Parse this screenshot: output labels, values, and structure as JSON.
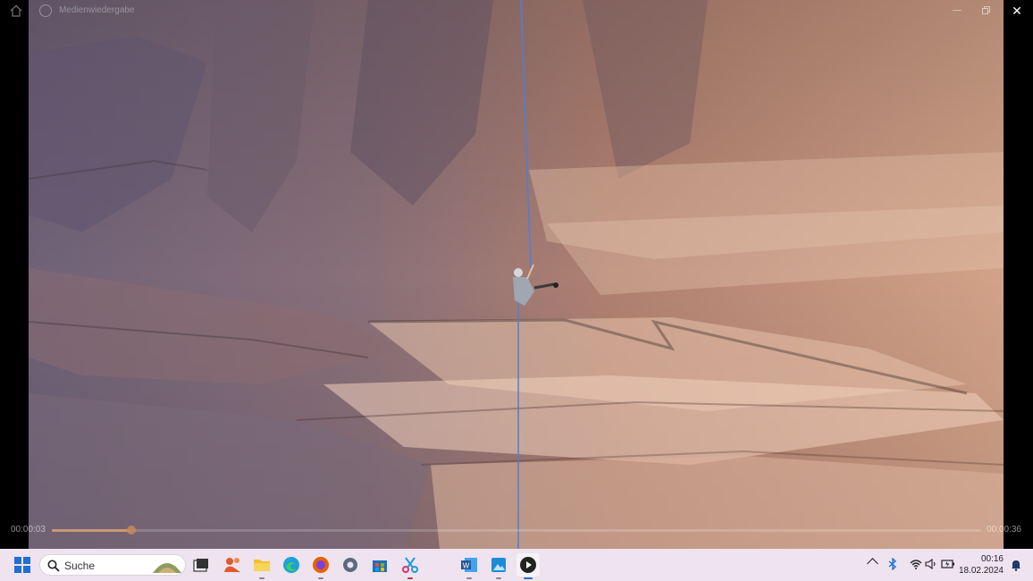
{
  "window": {
    "title": "Medienwiedergabe"
  },
  "playback": {
    "elapsed": "00:00:03",
    "total": "00:00:36",
    "progress_fraction": 0.086
  },
  "taskbar": {
    "search_label": "Suche",
    "apps": [
      {
        "name": "start",
        "icon": "windows-logo-icon",
        "color": "#1f6fd6"
      },
      {
        "name": "task-view",
        "icon": "task-view-icon",
        "color": "#333333"
      },
      {
        "name": "chat",
        "icon": "chat-icon",
        "color": "#e05a2b"
      },
      {
        "name": "file-explorer",
        "icon": "folder-icon",
        "color": "#f2c12e"
      },
      {
        "name": "edge",
        "icon": "edge-icon",
        "color": "#1da1d8"
      },
      {
        "name": "firefox",
        "icon": "firefox-icon",
        "color": "#e66000"
      },
      {
        "name": "settings",
        "icon": "gear-icon",
        "color": "#5b6b7d"
      },
      {
        "name": "store",
        "icon": "store-icon",
        "color": "#1b6ec2"
      },
      {
        "name": "snipping-tool",
        "icon": "scissors-icon",
        "color": "#1f9ad6"
      },
      {
        "name": "word",
        "icon": "word-icon",
        "color": "#2b579a"
      },
      {
        "name": "photos",
        "icon": "photos-icon",
        "color": "#1d8bd8"
      },
      {
        "name": "media-player",
        "icon": "media-player-icon",
        "color": "#222222"
      }
    ]
  },
  "tray": {
    "icons": [
      "chevron-up-icon",
      "bluetooth-icon",
      "wifi-icon",
      "volume-icon",
      "battery-icon"
    ],
    "time": "00:16",
    "date": "18.02.2024"
  }
}
